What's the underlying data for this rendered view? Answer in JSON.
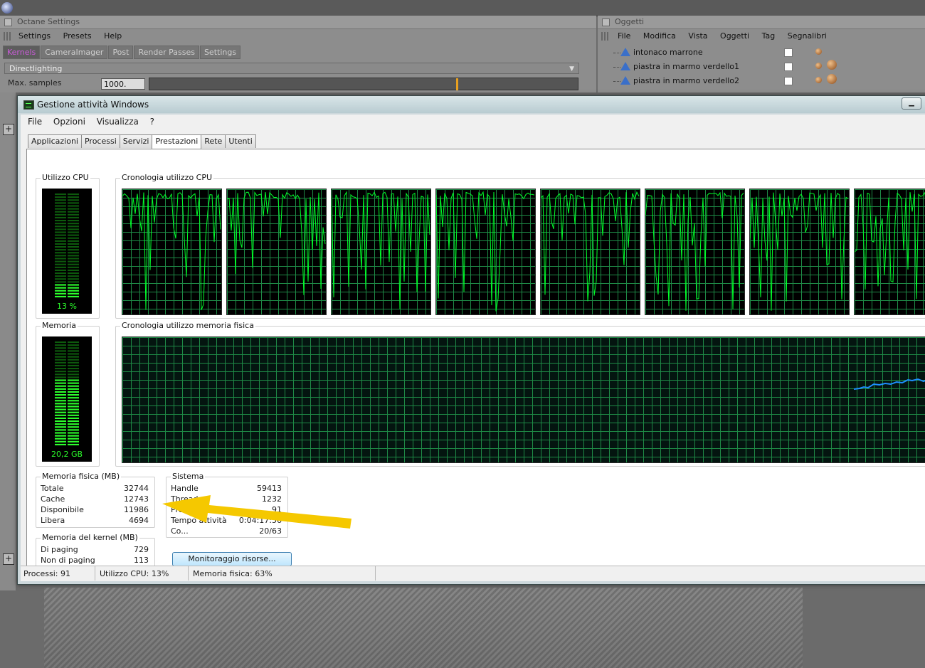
{
  "c4d": {
    "octane_title": "Octane Settings",
    "octane_menu": [
      "Settings",
      "Presets",
      "Help"
    ],
    "octane_tabs": [
      "Kernels",
      "CameraImager",
      "Post",
      "Render Passes",
      "Settings"
    ],
    "kernel_dropdown": "Directlighting",
    "max_samples_label": "Max. samples",
    "max_samples_value": "1000.",
    "objects_title": "Oggetti",
    "objects_menu": [
      "File",
      "Modifica",
      "Vista",
      "Oggetti",
      "Tag",
      "Segnalibri"
    ],
    "objects": [
      "intonaco marrone",
      "piastra in marmo verdello1",
      "piastra in marmo verdello2"
    ]
  },
  "task_manager": {
    "title": "Gestione attività Windows",
    "menu": [
      "File",
      "Opzioni",
      "Visualizza",
      "?"
    ],
    "tabs": [
      "Applicazioni",
      "Processi",
      "Servizi",
      "Prestazioni",
      "Rete",
      "Utenti"
    ],
    "active_tab": "Prestazioni",
    "cpu_usage_label": "Utilizzo CPU",
    "cpu_usage_value": "13 %",
    "cpu_usage_fraction": 0.13,
    "cpu_history_label": "Cronologia utilizzo CPU",
    "memory_label": "Memoria",
    "memory_value": "20,2 GB",
    "memory_fraction": 0.63,
    "memory_history_label": "Cronologia utilizzo memoria fisica",
    "physical_memory": {
      "label": "Memoria fisica (MB)",
      "rows": [
        {
          "name": "Totale",
          "value": "32744"
        },
        {
          "name": "Cache",
          "value": "12743"
        },
        {
          "name": "Disponibile",
          "value": "11986"
        },
        {
          "name": "Libera",
          "value": "4694"
        }
      ]
    },
    "kernel_memory": {
      "label": "Memoria del kernel (MB)",
      "rows": [
        {
          "name": "Di paging",
          "value": "729"
        },
        {
          "name": "Non di paging",
          "value": "113"
        }
      ]
    },
    "system": {
      "label": "Sistema",
      "rows": [
        {
          "name": "Handle",
          "value": "59413"
        },
        {
          "name": "Thread",
          "value": "1232"
        },
        {
          "name": "Processi",
          "value": "91"
        },
        {
          "name": "Tempo attività",
          "value": "0:04:17:56"
        },
        {
          "name": "Co...",
          "value": "20/63"
        }
      ]
    },
    "resource_monitor_button": "Monitoraggio risorse...",
    "status": {
      "processes": "Processi: 91",
      "cpu": "Utilizzo CPU: 13%",
      "memory": "Memoria fisica: 63%"
    }
  },
  "colors": {
    "graph_line": "#00ff2a",
    "grid": "#1e8a46",
    "memory_line": "#1e90ff",
    "annotation_arrow": "#f5c800"
  }
}
